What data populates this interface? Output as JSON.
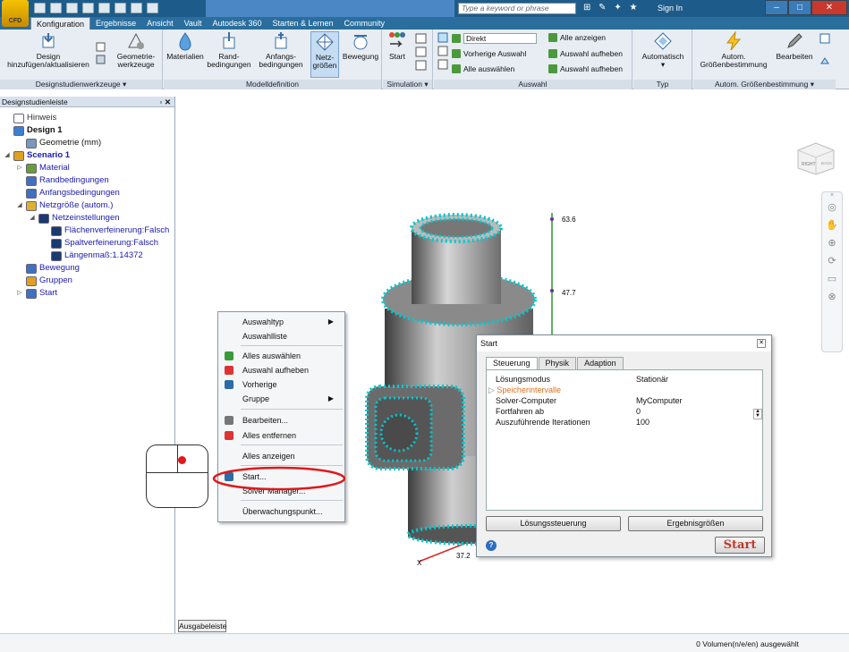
{
  "app": {
    "logo_text": "CFD",
    "search_placeholder": "Type a keyword or phrase",
    "sign_in": "Sign In"
  },
  "tabs": [
    "Konfiguration",
    "Ergebnisse",
    "Ansicht",
    "Vault",
    "Autodesk 360",
    "Starten & Lernen",
    "Community"
  ],
  "ribbon": {
    "groups": {
      "designstudien": "Designstudienwerkzeuge ▾",
      "modell": "Modelldefinition",
      "simulation": "Simulation ▾",
      "auswahl": "Auswahl",
      "typ": "Typ",
      "auto": "Autom. Größenbestimmung ▾"
    },
    "buttons": {
      "design": "Design",
      "design2": "hinzufügen/aktualisieren",
      "geometrie": "Geometrie-",
      "geometrie2": "werkzeuge",
      "materialien": "Materialien",
      "rand": "Rand-",
      "rand2": "bedingungen",
      "anfangs": "Anfangs-",
      "anfangs2": "bedingungen",
      "netz": "Netz-",
      "netz2": "größen",
      "bewegung": "Bewegung",
      "start": "Start",
      "automatisch": "Automatisch",
      "autom": "Autom.",
      "autom2": "Größenbestimmung",
      "bearbeiten": "Bearbeiten"
    },
    "selection": {
      "mode": "Direkt",
      "vorherige": "Vorherige Auswahl",
      "alle_auswaehlen": "Alle auswählen",
      "alle_anzeigen": "Alle anzeigen",
      "aufheben1": "Auswahl aufheben",
      "aufheben2": "Auswahl aufheben"
    }
  },
  "panel": {
    "title": "Designstudienleiste",
    "controls": "▫ ✕",
    "tree": [
      {
        "label": "Hinweis",
        "indent": 0,
        "color": "#333",
        "bold": false,
        "icon": "#fff"
      },
      {
        "label": "Design 1",
        "indent": 0,
        "color": "#111",
        "bold": true,
        "icon": "#3a7fd0"
      },
      {
        "label": "Geometrie (mm)",
        "indent": 1,
        "color": "#111",
        "bold": false,
        "icon": "#7799bb"
      },
      {
        "label": "Scenario 1",
        "indent": 0,
        "color": "#1a1ab0",
        "bold": true,
        "icon": "#e0a020",
        "tw": "◢"
      },
      {
        "label": "Material",
        "indent": 1,
        "color": "#1a1ab0",
        "bold": false,
        "icon": "#6a9c3a",
        "tw": "▷"
      },
      {
        "label": "Randbedingungen",
        "indent": 1,
        "color": "#1a1ab0",
        "bold": false,
        "icon": "#4070c0"
      },
      {
        "label": "Anfangsbedingungen",
        "indent": 1,
        "color": "#1a1ab0",
        "bold": false,
        "icon": "#4070c0"
      },
      {
        "label": "Netzgröße (autom.)",
        "indent": 1,
        "color": "#1a1ab0",
        "bold": false,
        "icon": "#e0b030",
        "tw": "◢"
      },
      {
        "label": "Netzeinstellungen",
        "indent": 2,
        "color": "#1a1ab0",
        "bold": false,
        "icon": "#1a3a70",
        "tw": "◢"
      },
      {
        "label": "Flächenverfeinerung:Falsch",
        "indent": 3,
        "color": "#1a1ab0",
        "bold": false,
        "icon": "#1a3a70"
      },
      {
        "label": "Spaltverfeinerung:Falsch",
        "indent": 3,
        "color": "#1a1ab0",
        "bold": false,
        "icon": "#1a3a70"
      },
      {
        "label": "Längenmaß:1.14372",
        "indent": 3,
        "color": "#1a1ab0",
        "bold": false,
        "icon": "#1a3a70"
      },
      {
        "label": "Bewegung",
        "indent": 1,
        "color": "#1a1ab0",
        "bold": false,
        "icon": "#4070c0"
      },
      {
        "label": "Gruppen",
        "indent": 1,
        "color": "#1a1ab0",
        "bold": false,
        "icon": "#e0a020"
      },
      {
        "label": "Start",
        "indent": 1,
        "color": "#1a1ab0",
        "bold": false,
        "icon": "#4070c0",
        "tw": "▷"
      }
    ]
  },
  "viewport": {
    "labels": {
      "a": "63.6",
      "b": "47.7",
      "c": "37.2",
      "d": "X"
    },
    "cube_right": "RIGHT",
    "cube_back": "BACK"
  },
  "context_menu": {
    "items": [
      {
        "label": "Auswahltyp",
        "sub": true
      },
      {
        "label": "Auswahlliste"
      },
      {
        "label": "Alles auswählen"
      },
      {
        "label": "Auswahl aufheben"
      },
      {
        "label": "Vorherige"
      },
      {
        "label": "Gruppe",
        "sub": true
      },
      {
        "label": "Bearbeiten..."
      },
      {
        "label": "Alles entfernen"
      },
      {
        "label": "Alles anzeigen"
      },
      {
        "label": "Start..."
      },
      {
        "label": "Solver Manager..."
      },
      {
        "label": "Überwachungspunkt..."
      }
    ]
  },
  "dialog": {
    "title": "Start",
    "tabs": [
      "Steuerung",
      "Physik",
      "Adaption"
    ],
    "rows": [
      {
        "k": "Lösungsmodus",
        "v": "Stationär"
      },
      {
        "k": "Speicherintervalle",
        "v": ""
      },
      {
        "k": "Solver-Computer",
        "v": "MyComputer"
      },
      {
        "k": "Fortfahren ab",
        "v": "0"
      },
      {
        "k": "Auszuführende Iterationen",
        "v": "100"
      }
    ],
    "btn_left": "Lösungssteuerung",
    "btn_right": "Ergebnisgrößen",
    "start": "Start"
  },
  "status": {
    "ausgabe": "Ausgabeleiste",
    "text": "0 Volumen(n/e/en) ausgewählt"
  },
  "colors": {
    "accent": "#00c8d0",
    "title": "#1d5c8a"
  }
}
